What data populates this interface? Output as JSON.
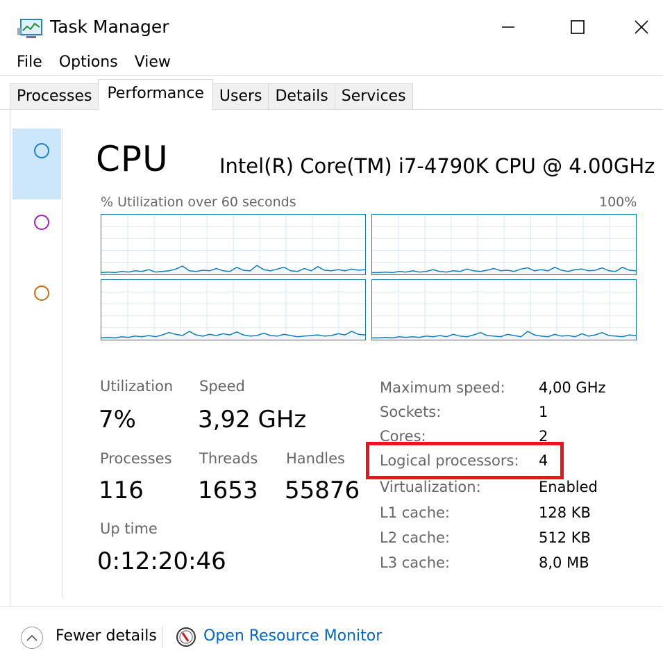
{
  "window": {
    "title": "Task Manager",
    "icon": "task-manager-icon",
    "controls": [
      "minimize-icon",
      "maximize-icon",
      "close-icon"
    ]
  },
  "menu": [
    "File",
    "Options",
    "View"
  ],
  "tabs": [
    {
      "label": "Processes",
      "active": false
    },
    {
      "label": "Performance",
      "active": true
    },
    {
      "label": "Users",
      "active": false
    },
    {
      "label": "Details",
      "active": false
    },
    {
      "label": "Services",
      "active": false
    }
  ],
  "sidebar": {
    "items": [
      {
        "ring_color": "#1a7fd0",
        "selected": true
      },
      {
        "ring_color": "#a020c8",
        "selected": false
      },
      {
        "ring_color": "#c86b14",
        "selected": false
      }
    ]
  },
  "cpu": {
    "title": "CPU",
    "model": "Intel(R) Core(TM) i7-4790K CPU @ 4.00GHz",
    "graph_caption": "% Utilization over 60 seconds",
    "graph_max": "100%",
    "graph_color": "#117dbb",
    "graphs": [
      [
        3,
        4,
        3,
        5,
        4,
        6,
        5,
        8,
        4,
        5,
        6,
        9,
        14,
        6,
        5,
        7,
        6,
        10,
        6,
        5,
        12,
        7,
        6,
        15,
        8,
        6,
        9,
        12,
        6,
        5,
        10,
        6,
        13,
        7,
        6,
        8,
        6,
        9,
        7,
        8
      ],
      [
        3,
        3,
        4,
        3,
        5,
        4,
        6,
        4,
        5,
        8,
        5,
        4,
        6,
        5,
        9,
        6,
        5,
        7,
        10,
        6,
        7,
        5,
        9,
        11,
        6,
        8,
        6,
        12,
        7,
        5,
        8,
        9,
        6,
        7,
        11,
        6,
        5,
        12,
        7,
        6
      ],
      [
        3,
        4,
        3,
        5,
        4,
        6,
        5,
        7,
        5,
        8,
        12,
        9,
        7,
        14,
        8,
        6,
        9,
        7,
        10,
        8,
        13,
        8,
        6,
        7,
        11,
        7,
        6,
        9,
        7,
        5,
        6,
        7,
        8,
        6,
        7,
        10,
        8,
        14,
        9,
        8
      ],
      [
        3,
        3,
        4,
        3,
        5,
        4,
        5,
        4,
        6,
        5,
        7,
        5,
        9,
        6,
        5,
        8,
        12,
        7,
        6,
        5,
        9,
        7,
        5,
        14,
        8,
        6,
        5,
        9,
        6,
        7,
        5,
        10,
        6,
        8,
        12,
        7,
        6,
        5,
        8,
        7
      ]
    ],
    "stats": {
      "utilization_label": "Utilization",
      "utilization": "7%",
      "speed_label": "Speed",
      "speed": "3,92 GHz",
      "processes_label": "Processes",
      "processes": "116",
      "threads_label": "Threads",
      "threads": "1653",
      "handles_label": "Handles",
      "handles": "55876",
      "uptime_label": "Up time",
      "uptime": "0:12:20:46"
    },
    "details": [
      {
        "key": "Maximum speed:",
        "value": "4,00 GHz"
      },
      {
        "key": "Sockets:",
        "value": "1"
      },
      {
        "key": "Cores:",
        "value": "2"
      },
      {
        "key": "Logical processors:",
        "value": "4"
      },
      {
        "key": "Virtualization:",
        "value": "Enabled"
      },
      {
        "key": "L1 cache:",
        "value": "128 KB"
      },
      {
        "key": "L2 cache:",
        "value": "512 KB"
      },
      {
        "key": "L3 cache:",
        "value": "8,0 MB"
      }
    ],
    "highlight_color": "#e8151f"
  },
  "footer": {
    "fewer_details": "Fewer details",
    "resource_monitor": "Open Resource Monitor",
    "link_color": "#0066cc"
  }
}
